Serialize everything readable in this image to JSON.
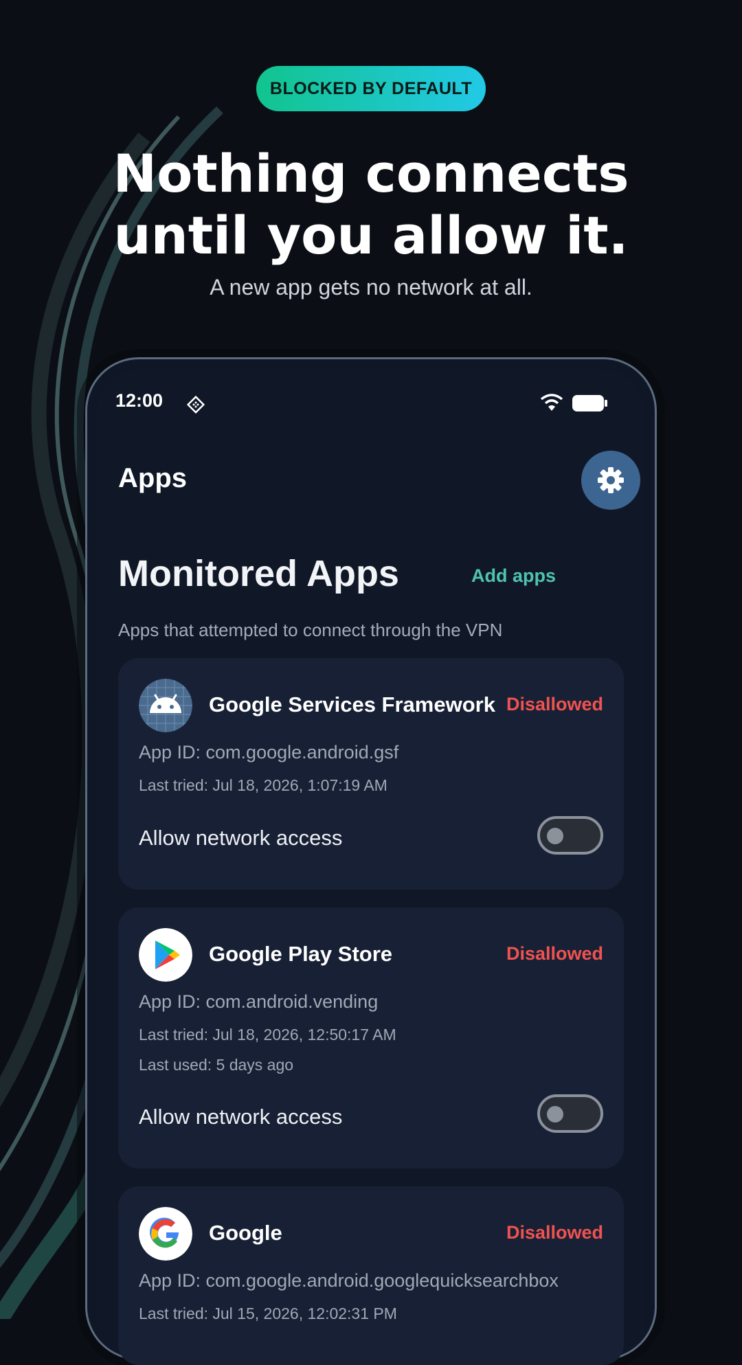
{
  "hero": {
    "badge": "BLOCKED BY DEFAULT",
    "headline_line1": "Nothing connects",
    "headline_line2": "until you allow it.",
    "subhead": "A new app gets no network at all."
  },
  "status_bar": {
    "time": "12:00"
  },
  "app_bar": {
    "title": "Apps",
    "settings_icon": "gear-icon"
  },
  "section": {
    "title": "Monitored Apps",
    "add_label": "Add apps",
    "description": "Apps that attempted to connect through the VPN"
  },
  "apps": [
    {
      "name": "Google Services Framework",
      "status": "Disallowed",
      "app_id": "App ID: com.google.android.gsf",
      "last_tried": "Last tried: Jul 18, 2026, 1:07:19 AM",
      "allow_label": "Allow network access",
      "allowed": false,
      "icon": "android-icon"
    },
    {
      "name": "Google Play Store",
      "status": "Disallowed",
      "app_id": "App ID: com.android.vending",
      "last_tried": "Last tried: Jul 18, 2026, 12:50:17 AM",
      "last_used": "Last used: 5 days ago",
      "allow_label": "Allow network access",
      "allowed": false,
      "icon": "play-store-icon"
    },
    {
      "name": "Google",
      "status": "Disallowed",
      "app_id": "App ID: com.google.android.googlequicksearchbox",
      "last_tried": "Last tried: Jul 15, 2026, 12:02:31 PM",
      "icon": "google-icon"
    }
  ],
  "colors": {
    "badge_gradient_start": "#12c48f",
    "badge_gradient_end": "#22c9e6",
    "accent_teal": "#4fc3b0",
    "status_red": "#f0534f",
    "card_bg": "#182035",
    "gear_button_bg": "#3d6591"
  }
}
